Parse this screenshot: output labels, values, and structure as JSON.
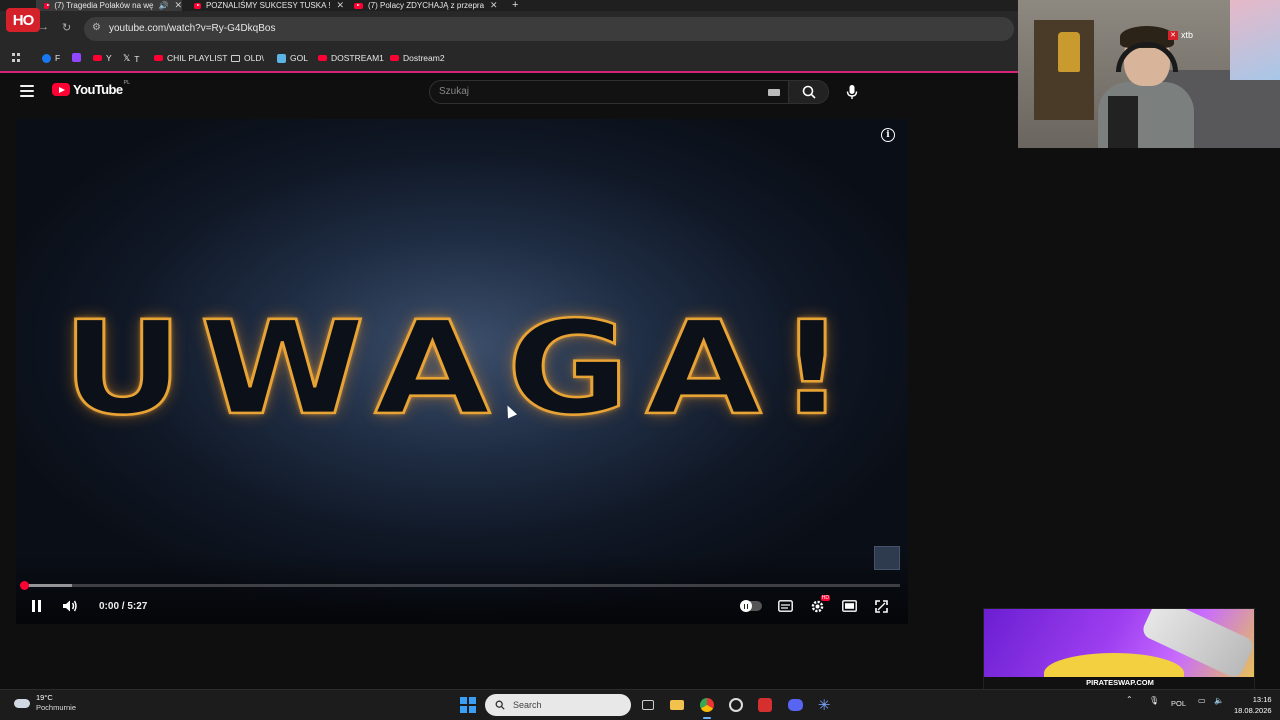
{
  "browser": {
    "tabs": [
      {
        "title": "(7) Tragedia Polaków na wę",
        "active": true
      },
      {
        "title": "POZNALIŚMY SUKCESY TUSKA !",
        "active": false
      },
      {
        "title": "(7) Polacy ZDYCHAJĄ z przepra",
        "active": false
      }
    ],
    "new_tab": "+",
    "url": "youtube.com/watch?v=Ry-G4DkqBos",
    "stream_logo": "HO",
    "bookmarks": [
      {
        "label": "F",
        "icon": "facebook-icon"
      },
      {
        "label": "",
        "icon": "twitch-icon"
      },
      {
        "label": "Y",
        "icon": "youtube-icon"
      },
      {
        "label": "T",
        "icon": "x-icon"
      },
      {
        "label": "CHIL PLAYLIST",
        "icon": "youtube-icon"
      },
      {
        "label": "OLD\\",
        "icon": "folder-icon"
      },
      {
        "label": "GOL",
        "icon": "gol-icon"
      },
      {
        "label": "DOSTREAM1",
        "icon": "youtube-icon"
      },
      {
        "label": "Dostream2",
        "icon": "youtube-icon"
      }
    ],
    "accent_color": "#d6247a"
  },
  "youtube": {
    "logo_text": "YouTube",
    "region": "PL",
    "search_placeholder": "Szukaj",
    "brand_color": "#ff0033"
  },
  "player": {
    "video_text": "UWAGA!",
    "time_current": "0:00",
    "time_total": "5:27",
    "time_display": "0:00 / 5:27",
    "progress_played_fraction": 0.0,
    "progress_loaded_fraction": 0.055,
    "hd_badge": "HD",
    "state": "playing"
  },
  "webcam": {
    "sponsor_label": "xtb"
  },
  "ad": {
    "caption": "PIRATESWAP.COM"
  },
  "taskbar": {
    "temperature": "19°C",
    "weather": "Pochmurnie",
    "search_label": "Search",
    "language": "POL",
    "time": "13:16",
    "date": "18.08.2026"
  }
}
